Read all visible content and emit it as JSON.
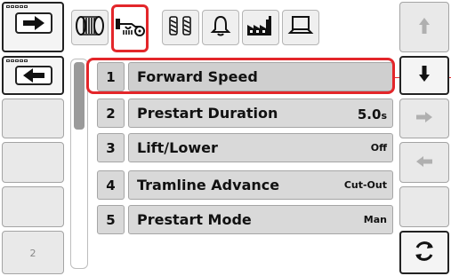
{
  "left_panel": {
    "buttons": [
      {
        "icon": "arrow-right-icon"
      },
      {
        "icon": "arrow-left-icon"
      },
      {
        "icon": ""
      },
      {
        "icon": ""
      },
      {
        "icon": ""
      }
    ],
    "page_number": "2"
  },
  "tabs": [
    {
      "icon": "implement-icon",
      "active": false
    },
    {
      "icon": "seed-drill-icon",
      "active": true
    },
    {
      "icon": "tramline-icon",
      "active": false
    },
    {
      "icon": "bell-icon",
      "active": false
    },
    {
      "icon": "factory-icon",
      "active": false
    },
    {
      "icon": "laptop-icon",
      "active": false
    }
  ],
  "list": {
    "selected_index": 0,
    "items": [
      {
        "number": "1",
        "label": "Forward Speed",
        "value": "",
        "unit": ""
      },
      {
        "number": "2",
        "label": "Prestart Duration",
        "value": "5.0",
        "unit": "s"
      },
      {
        "number": "3",
        "label": "Lift/Lower",
        "value": "Off",
        "unit": ""
      },
      {
        "number": "4",
        "label": "Tramline Advance",
        "value": "Cut-Out",
        "unit": ""
      },
      {
        "number": "5",
        "label": "Prestart Mode",
        "value": "Man",
        "unit": ""
      }
    ]
  },
  "right_panel": {
    "buttons": [
      {
        "icon": "arrow-up-icon",
        "enabled": false
      },
      {
        "icon": "arrow-down-icon",
        "enabled": true
      },
      {
        "icon": "arrow-right-icon",
        "enabled": false
      },
      {
        "icon": "arrow-left-icon",
        "enabled": false
      },
      {
        "icon": "blank",
        "enabled": false
      },
      {
        "icon": "refresh-icon",
        "enabled": true
      }
    ]
  },
  "colors": {
    "accent": "#e3262a",
    "button_bg": "#e9e9e9",
    "row_bg": "#d9d9d9",
    "disabled_icon": "#b0b0b0"
  }
}
